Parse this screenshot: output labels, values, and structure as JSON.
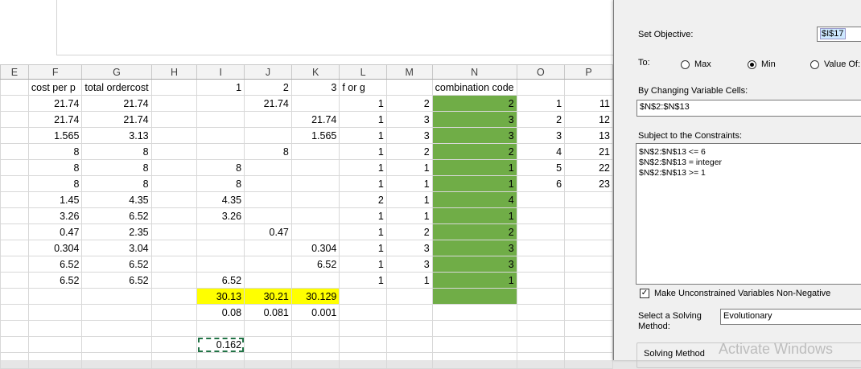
{
  "sheet": {
    "columns": [
      "E",
      "F",
      "G",
      "H",
      "I",
      "J",
      "K",
      "L",
      "M",
      "N",
      "O",
      "P"
    ],
    "rows": [
      [
        "",
        "cost per p",
        "total ordercost",
        "",
        "1",
        "2",
        "3",
        "f or g",
        "",
        "combination code",
        "",
        ""
      ],
      [
        "",
        "21.74",
        "21.74",
        "",
        "",
        "21.74",
        "",
        "1",
        "2",
        "2",
        "1",
        "11"
      ],
      [
        "",
        "21.74",
        "21.74",
        "",
        "",
        "",
        "21.74",
        "1",
        "3",
        "3",
        "2",
        "12"
      ],
      [
        "",
        "1.565",
        "3.13",
        "",
        "",
        "",
        "1.565",
        "1",
        "3",
        "3",
        "3",
        "13"
      ],
      [
        "",
        "8",
        "8",
        "",
        "",
        "8",
        "",
        "1",
        "2",
        "2",
        "4",
        "21"
      ],
      [
        "",
        "8",
        "8",
        "",
        "8",
        "",
        "",
        "1",
        "1",
        "1",
        "5",
        "22"
      ],
      [
        "",
        "8",
        "8",
        "",
        "8",
        "",
        "",
        "1",
        "1",
        "1",
        "6",
        "23"
      ],
      [
        "",
        "1.45",
        "4.35",
        "",
        "4.35",
        "",
        "",
        "2",
        "1",
        "4",
        "",
        ""
      ],
      [
        "",
        "3.26",
        "6.52",
        "",
        "3.26",
        "",
        "",
        "1",
        "1",
        "1",
        "",
        ""
      ],
      [
        "",
        "0.47",
        "2.35",
        "",
        "",
        "0.47",
        "",
        "1",
        "2",
        "2",
        "",
        ""
      ],
      [
        "",
        "0.304",
        "3.04",
        "",
        "",
        "",
        "0.304",
        "1",
        "3",
        "3",
        "",
        ""
      ],
      [
        "",
        "6.52",
        "6.52",
        "",
        "",
        "",
        "6.52",
        "1",
        "3",
        "3",
        "",
        ""
      ],
      [
        "",
        "6.52",
        "6.52",
        "",
        "6.52",
        "",
        "",
        "1",
        "1",
        "1",
        "",
        ""
      ],
      [
        "",
        "",
        "",
        "",
        "30.13",
        "30.21",
        "30.129",
        "",
        "",
        "",
        "",
        ""
      ],
      [
        "",
        "",
        "",
        "",
        "0.08",
        "0.081",
        "0.001",
        "",
        "",
        "",
        "",
        ""
      ],
      [
        "",
        "",
        "",
        "",
        "",
        "",
        "",
        "",
        "",
        "",
        "",
        ""
      ],
      [
        "",
        "",
        "",
        "",
        "0.162",
        "",
        "",
        "",
        "",
        "",
        "",
        ""
      ],
      [
        "",
        "",
        "",
        "",
        "",
        "",
        "",
        "",
        "",
        "",
        "",
        ""
      ]
    ],
    "green_fill": "#70ad47",
    "yellow_fill": "#ffff00"
  },
  "solver": {
    "set_objective_label": "Set Objective:",
    "objective_value": "$I$17",
    "to_label": "To:",
    "opt_max": "Max",
    "opt_min": "Min",
    "opt_value_of": "Value Of:",
    "selected_option": "Min",
    "changing_label": "By Changing Variable Cells:",
    "changing_value": "$N$2:$N$13",
    "constraints_label": "Subject to the Constraints:",
    "constraints": [
      "$N$2:$N$13 <= 6",
      "$N$2:$N$13 = integer",
      "$N$2:$N$13 >= 1"
    ],
    "nonneg_label": "Make Unconstrained Variables Non-Negative",
    "nonneg_checked": true,
    "method_label_1": "Select a Solving",
    "method_label_2": "Method:",
    "method_value": "Evolutionary",
    "solving_method_label": "Solving Method"
  },
  "watermark": "Activate Windows"
}
